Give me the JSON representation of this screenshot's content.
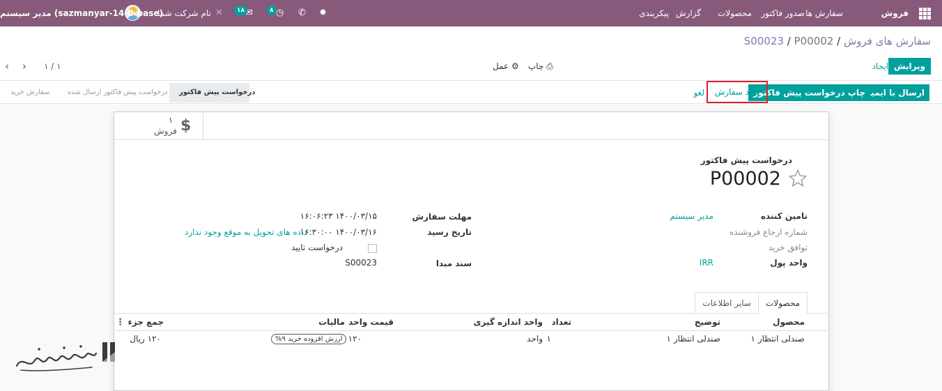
{
  "topbar": {
    "app_name": "فروش",
    "menu": [
      "سفارش ها",
      "صدور فاکتور",
      "محصولات",
      "گزارش",
      "پیکربندی"
    ],
    "company": "نام شرکت شما",
    "user": "مدیر سیستم (sazmanyar-14-0-base)",
    "messages_count": "۱۸",
    "activities_count": "۸"
  },
  "breadcrumb": {
    "root": "سفارش های فروش",
    "mid": "S00023",
    "current": "P00002"
  },
  "control": {
    "edit": "ویرایش",
    "create": "ایجاد",
    "print": "چاپ",
    "action": "عمل",
    "pager": "۱ / ۱"
  },
  "statusbar": {
    "buttons": {
      "send_email": "ارسال با ایمیل",
      "print_rfq": "چاپ درخواست پیش فاکتور",
      "confirm": "تایید سفارش",
      "cancel": "لغو"
    },
    "stages": [
      "درخواست پیش فاکتور",
      "درخواست پیش فاکتور ارسال شده",
      "سفارش خرید"
    ],
    "active_stage": "درخواست پیش فاکتور"
  },
  "smart_button": {
    "count": "۱",
    "label": "فروش"
  },
  "form": {
    "doc_type": "درخواست پیش فاکتور",
    "doc_name": "P00002",
    "right_fields": [
      {
        "label": "تامین کننده",
        "value": "مدیر سیستم"
      },
      {
        "label": "شماره ارجاع فروشنده",
        "value": ""
      },
      {
        "label": "توافق خرید",
        "value": ""
      },
      {
        "label": "واحد پول",
        "value": "IRR"
      }
    ],
    "left_fields": {
      "order_deadline_label": "مهلت سفارش",
      "order_deadline_value": "۱۴۰۰/۰۳/۱۵ ۱۶:۰۶:۲۳",
      "receipt_date_label": "تاریخ رسید",
      "receipt_date_value": "۱۴۰۰/۰۳/۱۶ ۱۶:۳۰:۰۰",
      "delivery_warning": "داده های تحویل به موقع وجود ندارد",
      "ask_confirmation": "درخواست تایید",
      "source_doc_label": "سند مبدا",
      "source_doc_value": "S00023"
    }
  },
  "tabs": [
    "محصولات",
    "سایر اطلاعات"
  ],
  "table": {
    "headers": [
      "محصول",
      "توضیح",
      "تعداد",
      "واحد اندازه گیری",
      "قیمت واحد",
      "مالیات",
      "جمع جزء"
    ],
    "rows": [
      {
        "product": "صندلی انتظار ۱",
        "description": "صندلی انتظار ۱",
        "quantity": "۱",
        "uom": "واحد",
        "unit_price": "۱۲۰",
        "tax": "ارزش افزوده خرید ۹%",
        "subtotal": "۱۲۰ ریال"
      }
    ]
  },
  "colors": {
    "brand": "#875a7b",
    "accent": "#00a09d",
    "highlight": "#e01e2b"
  }
}
